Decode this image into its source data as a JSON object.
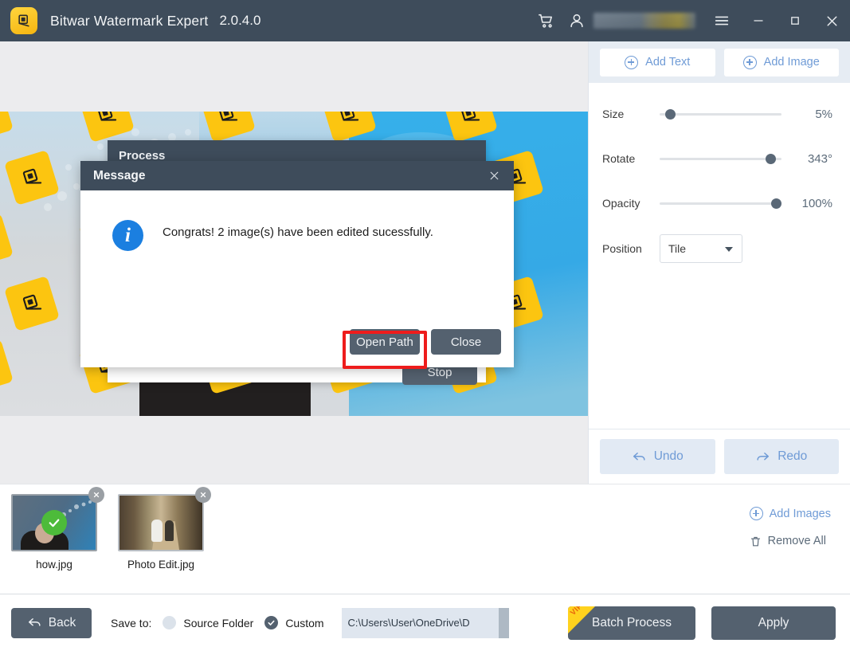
{
  "titlebar": {
    "app_name": "Bitwar Watermark Expert",
    "version": "2.0.4.0",
    "app_icon": "watermark-app-icon",
    "cart_icon": "shopping-cart-icon",
    "user_icon": "user-account-icon",
    "username_masked": "",
    "menu_icon": "hamburger-menu-icon",
    "minimize_label": "—",
    "maximize_label": "☐",
    "close_label": "✕",
    "bg_color": "#3e4c5b"
  },
  "right_panel": {
    "add_text_label": "Add Text",
    "add_image_label": "Add Image",
    "controls": [
      {
        "label": "Size",
        "value": "5%",
        "percent": 5
      },
      {
        "label": "Rotate",
        "value": "343°",
        "percent": 95
      },
      {
        "label": "Opacity",
        "value": "100%",
        "percent": 100
      }
    ],
    "position_label": "Position",
    "position_value": "Tile",
    "position_options": [
      "Tile"
    ],
    "undo_label": "Undo",
    "redo_label": "Redo",
    "accent_color": "#6f9bd6"
  },
  "thumbnails": {
    "items": [
      {
        "label": "how.jpg",
        "status": "done",
        "selected": true
      },
      {
        "label": "Photo Edit.jpg",
        "status": "pending",
        "selected": false
      }
    ],
    "add_images_label": "Add Images",
    "remove_all_label": "Remove All"
  },
  "bottombar": {
    "back_label": "Back",
    "save_to_label": "Save to:",
    "source_folder_label": "Source Folder",
    "custom_label": "Custom",
    "save_target": "Custom",
    "path_value": "C:\\Users\\User\\OneDrive\\D",
    "batch_process_label": "Batch Process",
    "vip_badge": "VIP",
    "apply_label": "Apply"
  },
  "process_dialog": {
    "title": "Process",
    "stop_label": "Stop"
  },
  "message_dialog": {
    "title": "Message",
    "close_label": "✕",
    "icon": "info-icon",
    "text": "Congrats! 2 image(s) have been edited sucessfully.",
    "open_path_label": "Open Path",
    "close_button_label": "Close",
    "highlight_color": "#ee1c1c"
  },
  "canvas": {
    "watermark_text": "watermark-tile",
    "tile_count": 24
  }
}
